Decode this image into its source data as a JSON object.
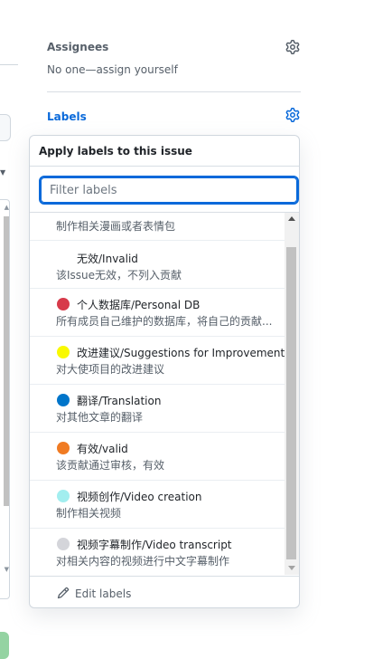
{
  "sidebar": {
    "assignees": {
      "heading": "Assignees",
      "value": "No one—assign yourself",
      "gear_icon": "gear-icon"
    },
    "labels": {
      "heading": "Labels",
      "gear_icon": "gear-icon"
    }
  },
  "dropdown": {
    "title": "Apply labels to this issue",
    "filter": {
      "placeholder": "Filter labels",
      "value": ""
    },
    "items": [
      {
        "name": "",
        "description": "制作相关漫画或者表情包",
        "color": ""
      },
      {
        "name": "无效/Invalid",
        "description": "该Issue无效，不列入贡献",
        "color": "#ffffff"
      },
      {
        "name": "个人数据库/Personal DB",
        "description": "所有成员自己维护的数据库，将自己的贡献...",
        "color": "#d73a4a"
      },
      {
        "name": "改进建议/Suggestions for Improvement",
        "description": "对大使项目的改进建议",
        "color": "#f9f900"
      },
      {
        "name": "翻译/Translation",
        "description": "对其他文章的翻译",
        "color": "#0075ca"
      },
      {
        "name": "有效/valid",
        "description": "该贡献通过审核，有效",
        "color": "#f07b23"
      },
      {
        "name": "视频创作/Video creation",
        "description": "制作相关视频",
        "color": "#a2eeef"
      },
      {
        "name": "视频字幕制作/Video transcript",
        "description": "对相关内容的视频进行中文字幕制作",
        "color": "#d4d5da"
      }
    ],
    "footer": {
      "label": "Edit labels",
      "icon": "pencil-icon"
    }
  },
  "colors": {
    "accent": "#0969da",
    "muted_text": "#57606a",
    "border": "#d0d7de"
  }
}
